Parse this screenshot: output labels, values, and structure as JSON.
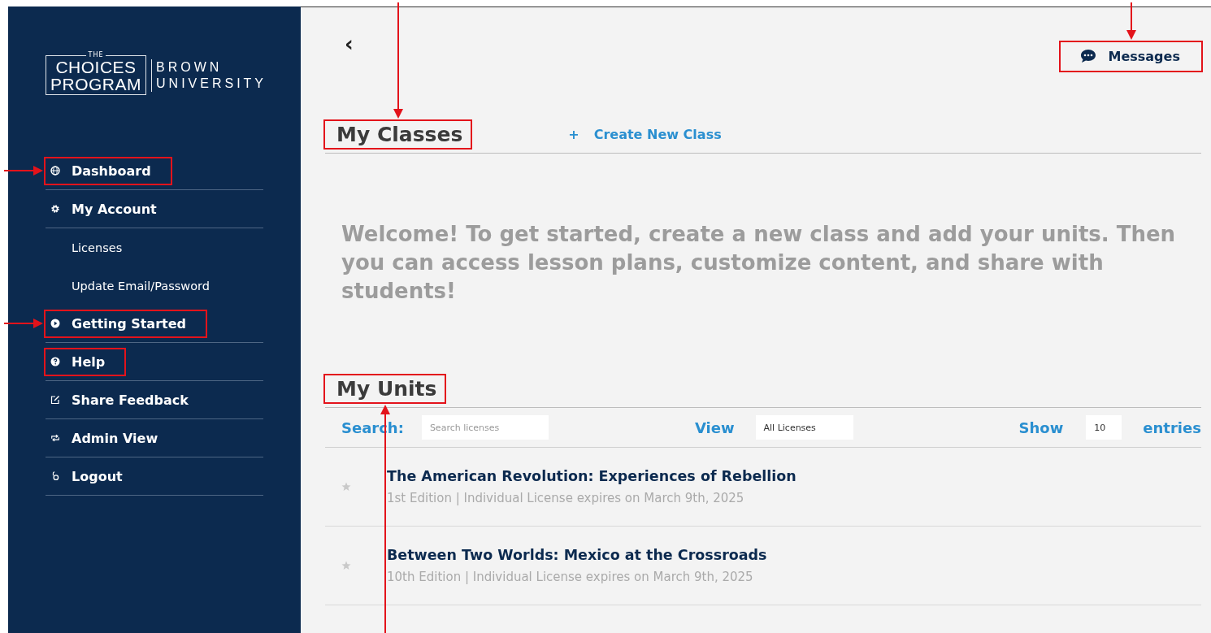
{
  "sidebar": {
    "logo": {
      "small": "THE",
      "line1": "CHOICES",
      "line2": "PROGRAM",
      "org1": "BROWN",
      "org2": "UNIVERSITY"
    },
    "items": [
      {
        "label": "Dashboard",
        "kind": "main",
        "highlighted": true,
        "arrow": {
          "kind": "left"
        }
      },
      {
        "label": "My Account",
        "kind": "main",
        "highlighted": false
      },
      {
        "label": "Licenses",
        "kind": "sub",
        "highlighted": false
      },
      {
        "label": "Update Email/Password",
        "kind": "sub",
        "highlighted": false
      },
      {
        "label": "Getting Started",
        "kind": "main",
        "highlighted": true,
        "arrow": {
          "kind": "left"
        }
      },
      {
        "label": "Help",
        "kind": "main",
        "highlighted": true
      },
      {
        "label": "Share Feedback",
        "kind": "main",
        "highlighted": false
      },
      {
        "label": "Admin View",
        "kind": "main",
        "highlighted": false
      },
      {
        "label": "Logout",
        "kind": "main",
        "highlighted": false
      }
    ]
  },
  "topbar": {
    "back": "‹",
    "messages": {
      "label": "Messages",
      "highlighted": true,
      "arrow": {
        "kind": "top"
      }
    }
  },
  "classes": {
    "title": "My Classes",
    "highlighted": true,
    "arrow": {
      "kind": "top"
    },
    "create": {
      "icon": "+",
      "label": "Create New Class"
    },
    "welcome": "Welcome! To get started, create a new class and add your units. Then you can access lesson plans, customize content, and share with students!"
  },
  "units": {
    "title": "My Units",
    "highlighted": true,
    "arrow": {
      "kind": "bottom"
    },
    "search": {
      "label": "Search:",
      "placeholder": "Search licenses"
    },
    "view": {
      "label": "View",
      "value": "All Licenses"
    },
    "show": {
      "label": "Show",
      "value": "10",
      "suffix": "entries"
    },
    "rows": [
      {
        "title": "The American Revolution: Experiences of Rebellion",
        "detail": "1st Edition | Individual License expires on March 9th, 2025",
        "favorite": false
      },
      {
        "title": "Between Two Worlds: Mexico at the Crossroads",
        "detail": "10th Edition | Individual License expires on March 9th, 2025",
        "favorite": false
      }
    ]
  }
}
